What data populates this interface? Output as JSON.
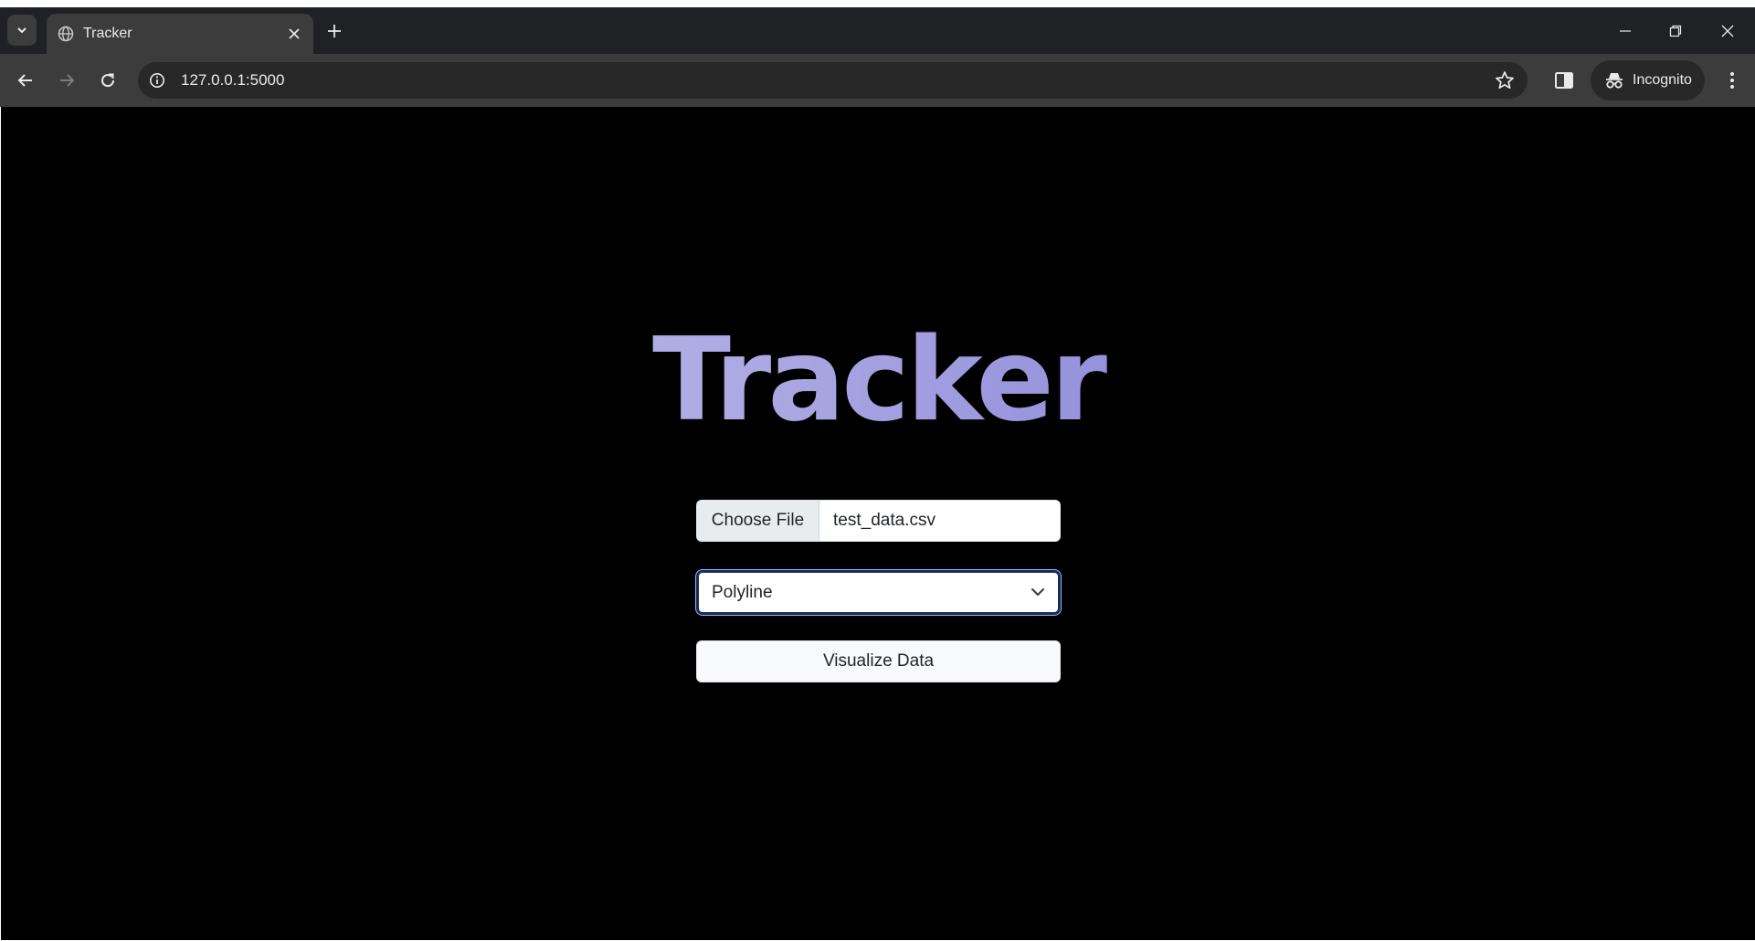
{
  "browser": {
    "tab": {
      "title": "Tracker"
    },
    "address": {
      "url": "127.0.0.1:5000"
    },
    "profile": {
      "label": "Incognito"
    }
  },
  "page": {
    "heading": "Tracker",
    "file_input": {
      "button_label": "Choose File",
      "file_name": "test_data.csv"
    },
    "chart_type_select": {
      "selected": "Polyline"
    },
    "submit_button": {
      "label": "Visualize Data"
    }
  },
  "colors": {
    "page_background": "#000000",
    "heading_gradient": [
      "#d4d2f2",
      "#aaa6e2",
      "#6b66cf"
    ],
    "select_focus_border": "#1c2b52",
    "chrome_dark": "#202124",
    "chrome_toolbar": "#3c3c3c"
  },
  "icons": [
    "tab-search-icon",
    "globe-icon",
    "close-icon",
    "plus-icon",
    "minimize-icon",
    "restore-icon",
    "window-close-icon",
    "back-arrow-icon",
    "forward-arrow-icon",
    "reload-icon",
    "info-icon",
    "star-icon",
    "side-panel-icon",
    "incognito-icon",
    "kebab-menu-icon",
    "chevron-down-icon"
  ]
}
